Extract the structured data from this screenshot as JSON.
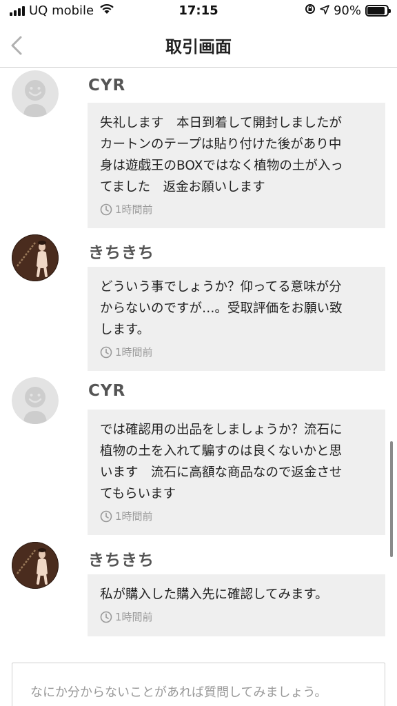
{
  "status_bar": {
    "carrier": "UQ mobile",
    "time": "17:15",
    "battery": "90%",
    "battery_level": 0.9
  },
  "nav": {
    "title": "取引画面"
  },
  "messages": [
    {
      "sender": "CYR",
      "avatar": "default-avatar",
      "text": "失礼します　本日到着して開封しましたが\nカートンのテープは貼り付けた後があり中\n身は遊戯王のBOXではなく植物の土が入っ\nてました　返金お願いします",
      "time": "1時間前"
    },
    {
      "sender": "きちきち",
      "avatar": "photo-avatar",
      "text": "どういう事でしょうか？仰ってる意味が分\nからないのですが…。受取評価をお願い致\nします。",
      "time": "1時間前"
    },
    {
      "sender": "CYR",
      "avatar": "default-avatar",
      "text": "では確認用の出品をしましょうか？流石に\n植物の土を入れて騙すのは良くないかと思\nいます　流石に高額な商品なので返金させ\nてもらいます",
      "time": "1時間前"
    },
    {
      "sender": "きちきち",
      "avatar": "photo-avatar",
      "text": "私が購入した購入先に確認してみます。",
      "time": "1時間前"
    }
  ],
  "input": {
    "placeholder": "なにか分からないことがあれば質問してみましょう。"
  }
}
